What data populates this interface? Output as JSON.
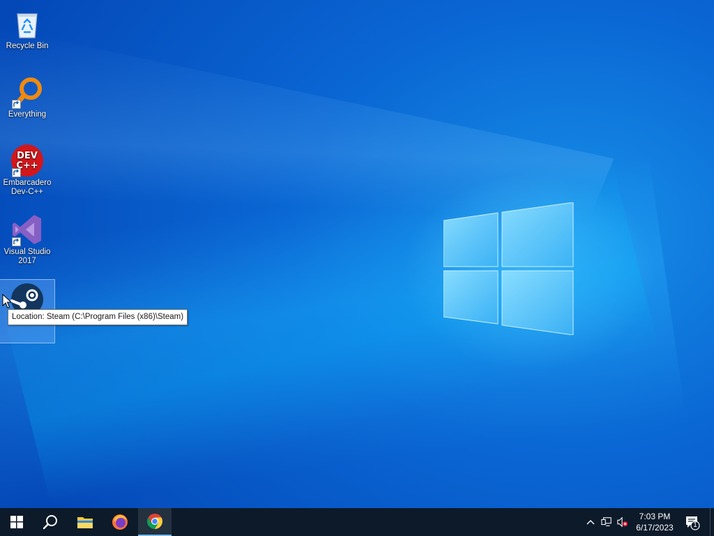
{
  "desktop": {
    "icons": [
      {
        "label": "Recycle Bin"
      },
      {
        "label": "Everything"
      },
      {
        "label": "Embarcadero Dev-C++",
        "glyph_line1": "DEV",
        "glyph_line2": "C++"
      },
      {
        "label": "Visual Studio 2017"
      },
      {
        "label": "Steam"
      }
    ],
    "selected_icon": "Steam",
    "tooltip": "Location: Steam (C:\\Program Files (x86)\\Steam)"
  },
  "taskbar": {
    "pinned": [
      "start-icon",
      "search-icon",
      "file-explorer-icon",
      "firefox-icon",
      "chrome-icon"
    ],
    "active_app": "chrome",
    "clock": {
      "time": "7:03 PM",
      "date": "6/17/2023"
    },
    "notification_count": "1",
    "tray_icons": [
      "show-hidden-icons-chevron",
      "network-icon",
      "volume-muted-icon"
    ]
  },
  "colors": {
    "taskbar_bg": "#0c1a2a",
    "desktop_blue": "#0a67d4",
    "accent": "#76b9ed"
  }
}
